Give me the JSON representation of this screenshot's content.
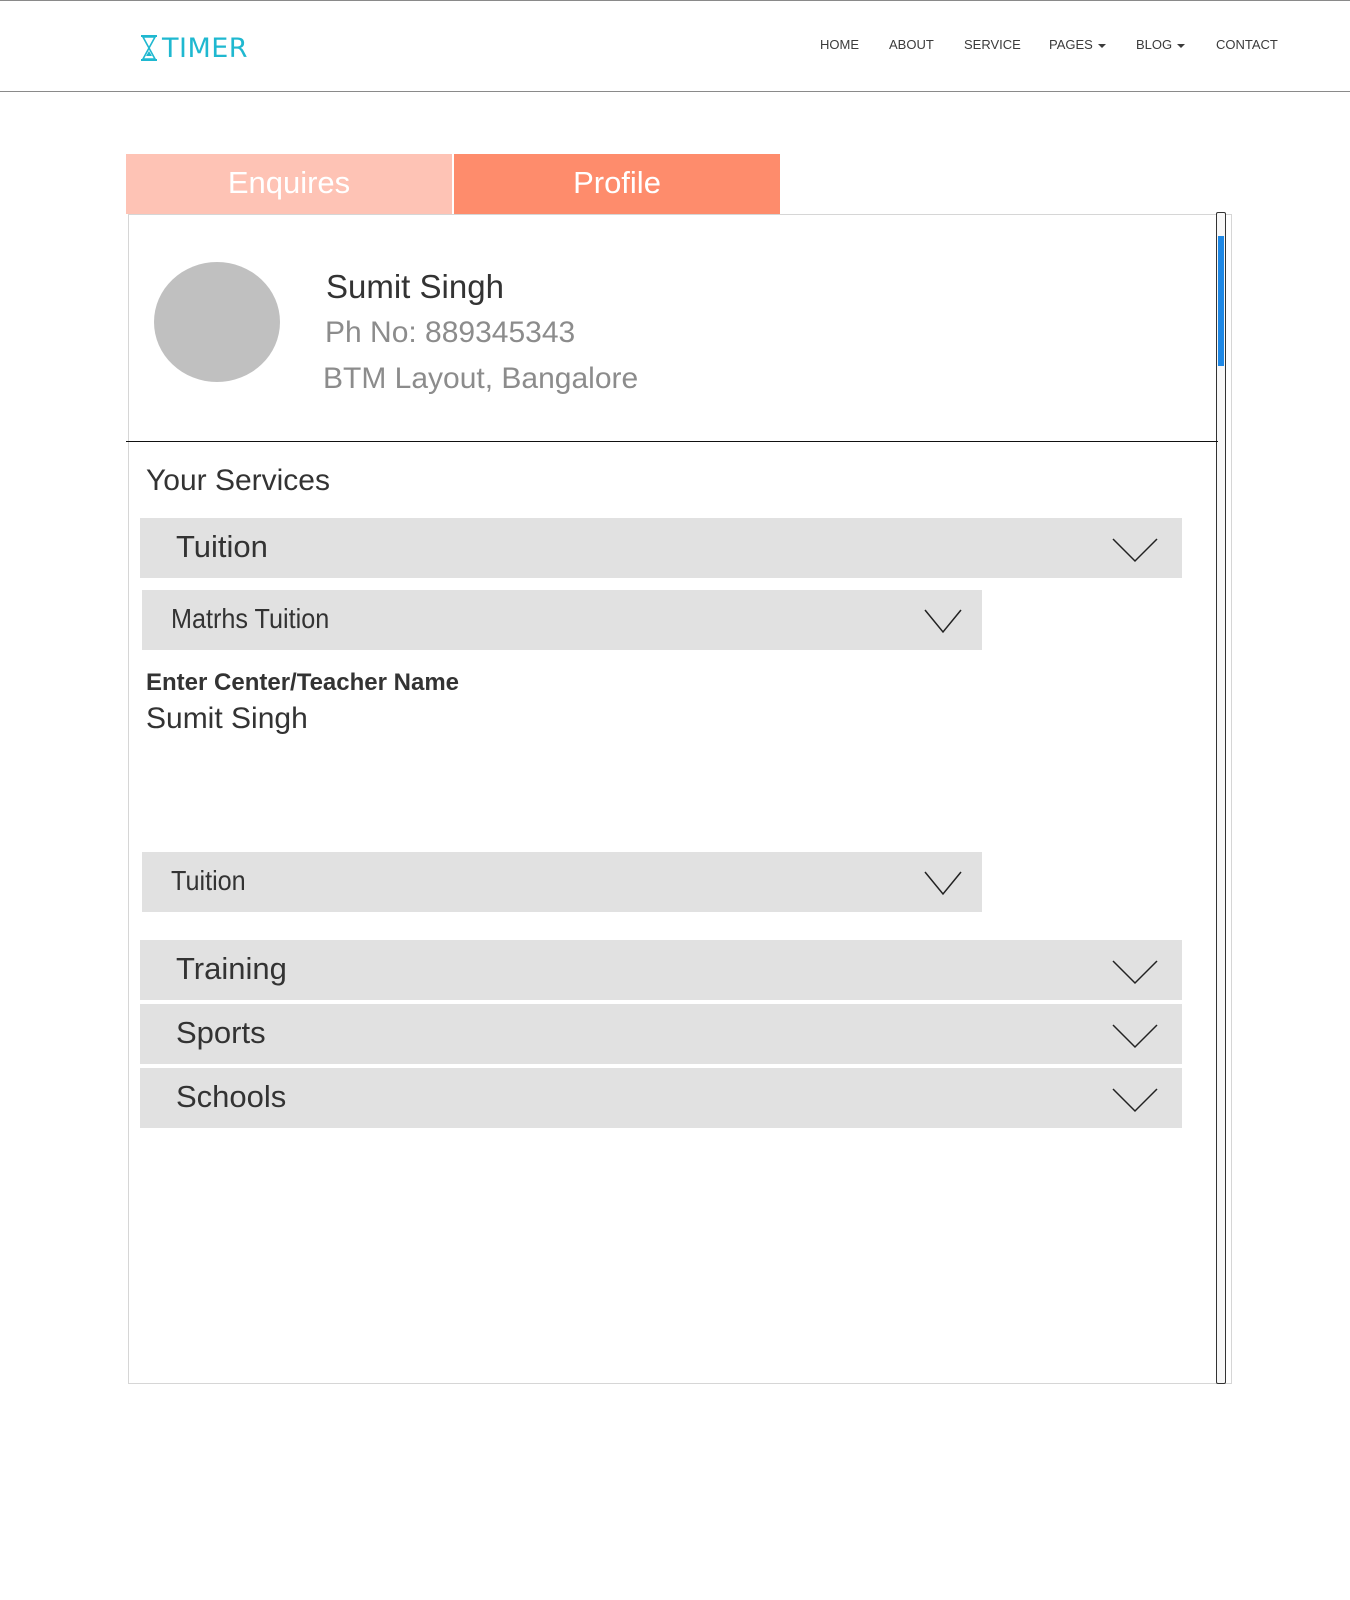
{
  "header": {
    "logo_text": "TIMER",
    "nav": [
      {
        "label": "HOME",
        "dropdown": false
      },
      {
        "label": "ABOUT",
        "dropdown": false
      },
      {
        "label": "SERVICE",
        "dropdown": false
      },
      {
        "label": "PAGES",
        "dropdown": true
      },
      {
        "label": "BLOG",
        "dropdown": true
      },
      {
        "label": "CONTACT",
        "dropdown": false
      }
    ]
  },
  "tabs": [
    {
      "label": "Enquires",
      "active": false
    },
    {
      "label": "Profile",
      "active": true
    }
  ],
  "profile": {
    "name": "Sumit Singh",
    "phone": "Ph No: 889345343",
    "location": "BTM Layout, Bangalore"
  },
  "services": {
    "title": "Your Services",
    "categories": [
      {
        "label": "Tuition",
        "expanded": true
      },
      {
        "label": "Training",
        "expanded": false
      },
      {
        "label": "Sports",
        "expanded": false
      },
      {
        "label": "Schools",
        "expanded": false
      }
    ],
    "sub_select_1": "Matrhs Tuition",
    "field_label": "Enter Center/Teacher Name",
    "field_value": "Sumit Singh",
    "sub_select_2": "Tuition"
  },
  "colors": {
    "logo": "#1fb8d0",
    "tab_inactive": "#fec3b5",
    "tab_active": "#fe8c6c",
    "accordion_bg": "#e1e1e1",
    "scroll_thumb": "#1e88e5",
    "avatar": "#c0c0c0"
  },
  "icons": {
    "logo": "hourglass-icon",
    "accordion": "chevron-down-icon",
    "nav_dropdown": "caret-down-icon"
  }
}
